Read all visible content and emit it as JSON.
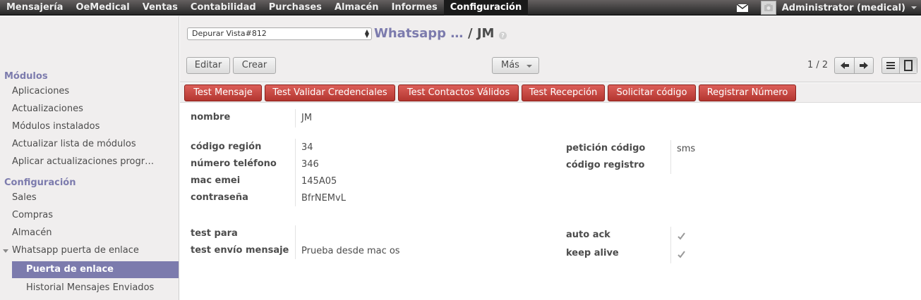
{
  "topbar": {
    "menu": [
      "Mensajería",
      "OeMedical",
      "Ventas",
      "Contabilidad",
      "Purchases",
      "Almacén",
      "Informes",
      "Configuración"
    ],
    "active_index": 7,
    "user_name": "Administrator (medical)",
    "icons": [
      "mail-icon",
      "avatar-icon",
      "caret-down-icon"
    ]
  },
  "sidebar": {
    "heading_modulos": "Módulos",
    "modulos_items": [
      "Aplicaciones",
      "Actualizaciones",
      "Módulos instalados",
      "Actualizar lista de módulos",
      "Aplicar actualizaciones progr…"
    ],
    "heading_config": "Configuración",
    "config_items": [
      "Sales",
      "Compras",
      "Almacén"
    ],
    "whatsapp_group": "Whatsapp puerta de enlace",
    "whatsapp_sub": [
      "Puerta de enlace",
      "Historial Mensajes Enviados"
    ],
    "selected": "Puerta de enlace"
  },
  "header": {
    "debug_select_value": "Depurar Vista#812",
    "breadcrumb_parent": "Whatsapp …",
    "breadcrumb_sep_current": "/ JM",
    "help_mark": "?",
    "edit_button": "Editar",
    "create_button": "Crear",
    "more_button": "Más",
    "pager": "1 / 2"
  },
  "actions": [
    "Test Mensaje",
    "Test Validar Credenciales",
    "Test Contactos Válidos",
    "Test Recepción",
    "Solicitar código",
    "Registrar Número"
  ],
  "form": {
    "nombre_label": "nombre",
    "nombre_value": "JM",
    "codigo_region_label": "código región",
    "codigo_region_value": "34",
    "numero_telefono_label": "número teléfono",
    "numero_telefono_value": "346",
    "mac_emei_label": "mac emei",
    "mac_emei_value": "145A05",
    "contrasena_label": "contraseña",
    "contrasena_value": "BfrNEMvL",
    "peticion_codigo_label": "petición código",
    "peticion_codigo_value": "sms",
    "codigo_registro_label": "código registro",
    "codigo_registro_value": "",
    "test_para_label": "test para",
    "test_para_value": "",
    "test_envio_label": "test envío mensaje",
    "test_envio_value": "Prueba desde mac os",
    "auto_ack_label": "auto ack",
    "auto_ack_checked": true,
    "keep_alive_label": "keep alive",
    "keep_alive_checked": true
  },
  "colors": {
    "accent": "#7c7bad",
    "action_red": "#c9403a",
    "topbar": "#3a3838"
  }
}
